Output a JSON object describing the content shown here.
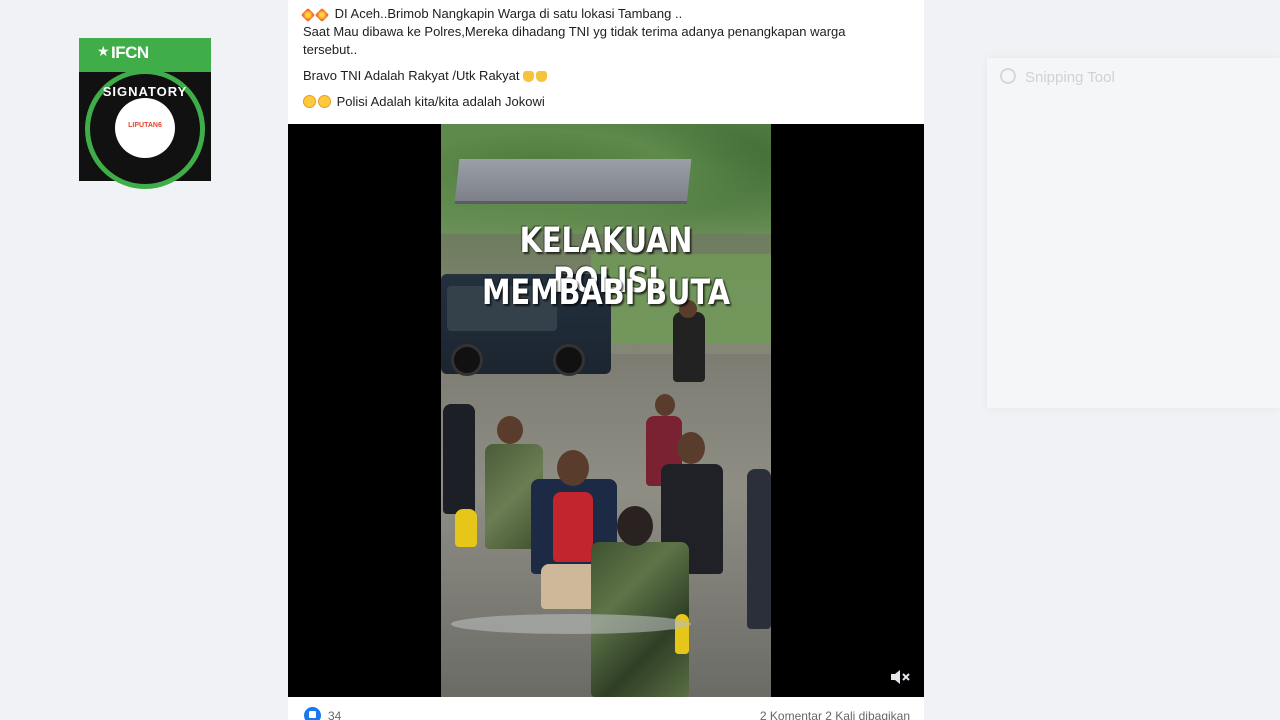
{
  "badge": {
    "ifcn": "IFCN",
    "signatory": "SIGNATORY",
    "partner": "LIPUTAN6"
  },
  "post": {
    "lines": [
      "DI Aceh..Brimob Nangkapin Warga di satu lokasi Tambang ..",
      "Saat Mau dibawa ke Polres,Mereka dihadang TNI yg tidak terima adanya penangkapan warga tersebut..",
      "Bravo TNI Adalah Rakyat /Utk  Rakyat",
      "Polisi Adalah kita/kita adalah Jokowi"
    ]
  },
  "video": {
    "caption_line1": "KELAKUAN POLISI",
    "caption_line2": "MEMBABI BUTA"
  },
  "footer": {
    "reactions": "34",
    "comments_shares": "2 Komentar  2 Kali dibagikan"
  },
  "snipping_tool": {
    "title": "Snipping Tool"
  },
  "icons": {
    "burst": "collision-emoji-icon",
    "thumb": "thumbs-up-emoji-icon",
    "face": "angry-face-emoji-icon",
    "like": "like-reaction-icon",
    "mute": "speaker-muted-icon"
  },
  "colors": {
    "fb_blue": "#1877f2",
    "ifcn_green": "#3fae49"
  }
}
